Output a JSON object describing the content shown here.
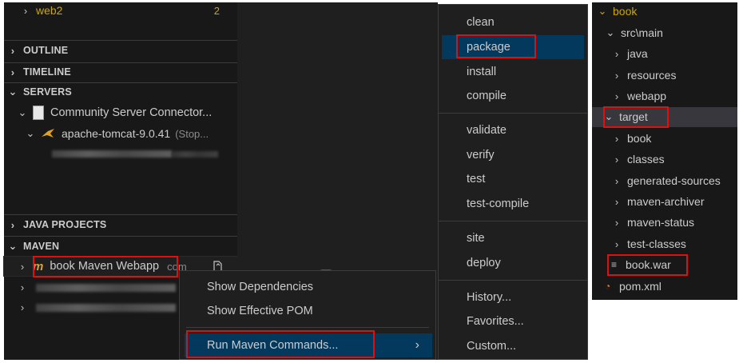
{
  "explorer": {
    "web2": {
      "label": "web2",
      "badge": "2"
    },
    "outline": "OUTLINE",
    "timeline": "TIMELINE",
    "servers": "SERVERS",
    "server_connector": "Community Server Connector...",
    "tomcat": {
      "label": "apache-tomcat-9.0.41",
      "status": "(Stop..."
    },
    "java_projects": "JAVA PROJECTS",
    "maven": "MAVEN",
    "maven_project": "book Maven Webapp",
    "maven_project_suffix": "com"
  },
  "context_menu": {
    "show_dependencies": "Show Dependencies",
    "show_effective_pom": "Show Effective POM",
    "run_maven_commands": "Run Maven Commands..."
  },
  "maven_commands": {
    "group1": [
      "clean",
      "package",
      "install",
      "compile"
    ],
    "group2": [
      "validate",
      "verify",
      "test",
      "test-compile"
    ],
    "group3": [
      "site",
      "deploy"
    ],
    "group4": [
      "History...",
      "Favorites...",
      "Custom..."
    ]
  },
  "file_tree": {
    "root": "book",
    "src_main": "src\\main",
    "java": "java",
    "resources": "resources",
    "webapp": "webapp",
    "target": "target",
    "target_children": [
      "book",
      "classes",
      "generated-sources",
      "maven-archiver",
      "maven-status",
      "test-classes"
    ],
    "war": "book.war",
    "pom": "pom.xml"
  },
  "colors": {
    "highlight_box": "#e01010",
    "selection": "#04395e",
    "badge": "#cca700",
    "maven_icon": "#d7a23a"
  }
}
